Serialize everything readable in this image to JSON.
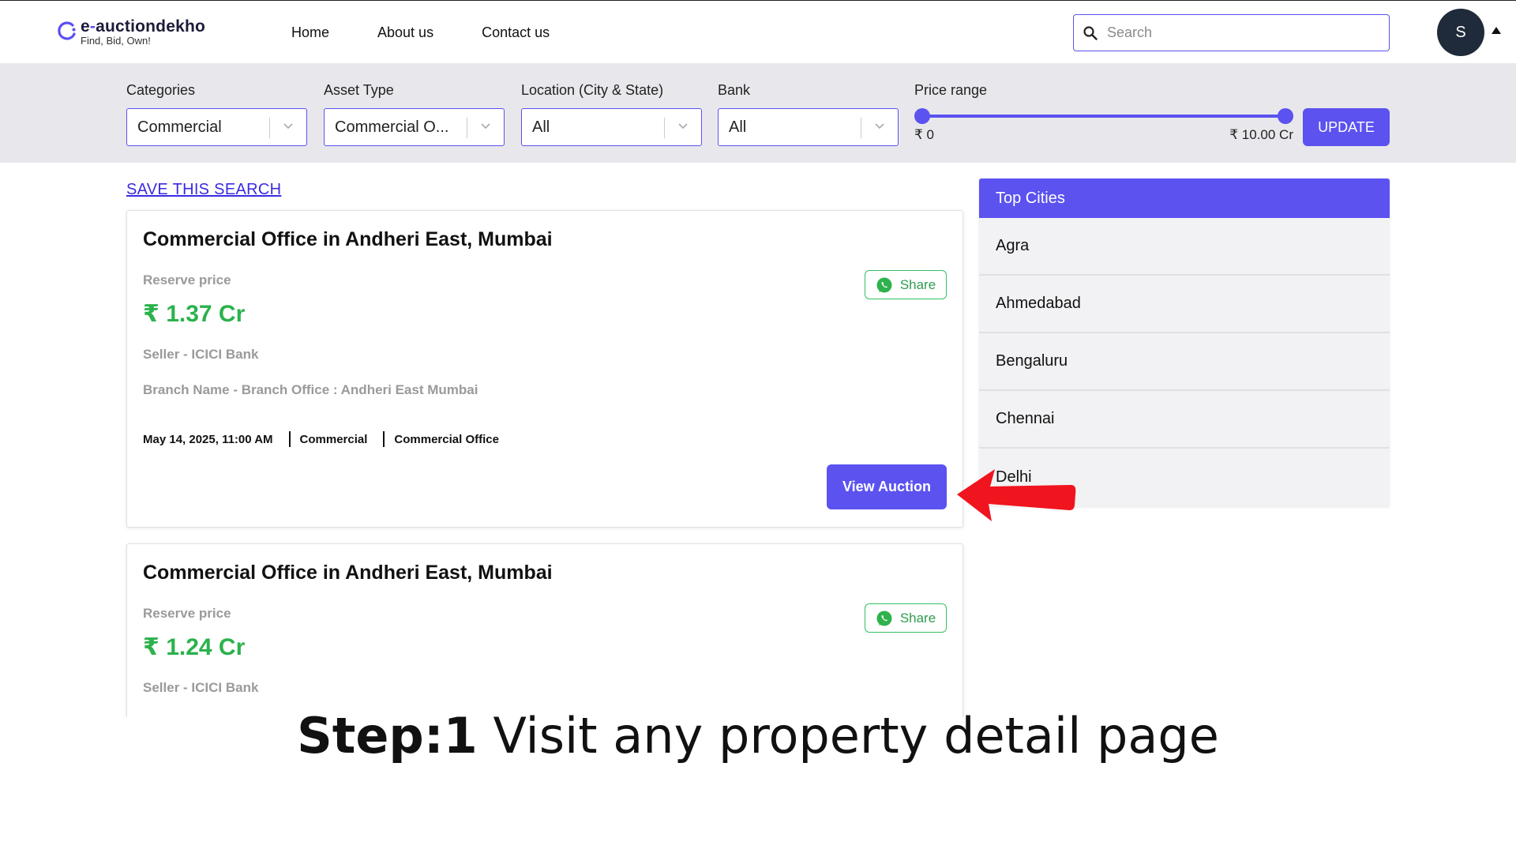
{
  "header": {
    "logo_name": "e-auctiondekho",
    "logo_tagline": "Find, Bid, Own!",
    "nav": [
      "Home",
      "About us",
      "Contact us"
    ],
    "search_placeholder": "Search",
    "avatar_initial": "S"
  },
  "filters": {
    "categories": {
      "label": "Categories",
      "value": "Commercial"
    },
    "asset_type": {
      "label": "Asset Type",
      "value": "Commercial O..."
    },
    "location": {
      "label": "Location (City & State)",
      "value": "All"
    },
    "bank": {
      "label": "Bank",
      "value": "All"
    },
    "price": {
      "label": "Price range",
      "min": "₹ 0",
      "max": "₹ 10.00 Cr"
    },
    "update_label": "UPDATE"
  },
  "save_search_label": "SAVE THIS SEARCH",
  "listings": [
    {
      "title": "Commercial Office in Andheri East, Mumbai",
      "reserve_label": "Reserve price",
      "reserve_value": "₹ 1.37 Cr",
      "seller": "Seller -  ICICI Bank",
      "branch": "Branch Name -  Branch Office : Andheri East Mumbai",
      "date": "May 14, 2025, 11:00 AM",
      "category": "Commercial",
      "asset_type": "Commercial Office",
      "share_label": "Share",
      "view_label": "View Auction"
    },
    {
      "title": "Commercial Office in Andheri East, Mumbai",
      "reserve_label": "Reserve price",
      "reserve_value": "₹ 1.24 Cr",
      "seller": "Seller -  ICICI Bank",
      "share_label": "Share"
    }
  ],
  "top_cities": {
    "title": "Top Cities",
    "items": [
      "Agra",
      "Ahmedabad",
      "Bengaluru",
      "Chennai",
      "Delhi"
    ]
  },
  "caption": {
    "bold": "Step:1",
    "text": " Visit any property detail page"
  },
  "colors": {
    "accent": "#5b52f0",
    "price_green": "#2bb24c",
    "arrow_red": "#f0141e"
  }
}
